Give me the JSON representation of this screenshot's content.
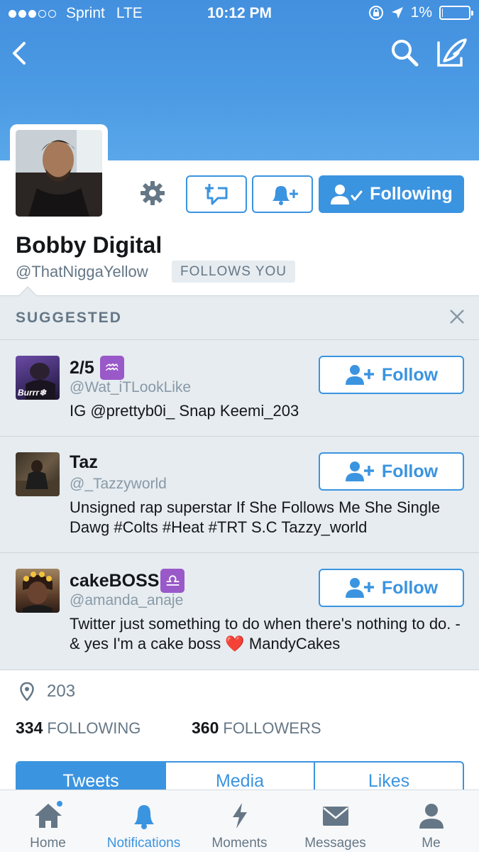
{
  "status_bar": {
    "carrier": "Sprint",
    "network": "LTE",
    "time": "10:12 PM",
    "battery_pct": "1%",
    "battery_level": 0.03
  },
  "profile": {
    "name": "Bobby Digital",
    "handle": "@ThatNiggaYellow",
    "follows_you": "FOLLOWS YOU",
    "following_label": "Following",
    "location": "203",
    "following_count": "334",
    "following_label_caps": "FOLLOWING",
    "followers_count": "360",
    "followers_label_caps": "FOLLOWERS"
  },
  "suggested": {
    "header": "SUGGESTED",
    "follow_label": "Follow",
    "items": [
      {
        "name": "2/5",
        "zodiac": "♒",
        "handle": "@Wat_iTLookLike",
        "bio": "IG @prettyb0i_ Snap Keemi_203",
        "avatar_text": "Burrr❄"
      },
      {
        "name": "Taz",
        "handle": "@_Tazzyworld",
        "bio": "Unsigned rap superstar If She Follows Me She Single Dawg #Colts #Heat #TRT S.C Tazzy_world"
      },
      {
        "name": "cakeBOSS",
        "zodiac": "♎",
        "handle": "@amanda_anaje",
        "bio": "Twitter just something to do when there's nothing to do. - & yes I'm a cake boss ❤️  MandyCakes"
      }
    ]
  },
  "tabs": [
    "Tweets",
    "Media",
    "Likes"
  ],
  "tabbar": [
    {
      "label": "Home",
      "icon": "home-icon"
    },
    {
      "label": "Notifications",
      "icon": "bell-icon"
    },
    {
      "label": "Moments",
      "icon": "lightning-icon"
    },
    {
      "label": "Messages",
      "icon": "envelope-icon"
    },
    {
      "label": "Me",
      "icon": "person-icon"
    }
  ],
  "colors": {
    "accent": "#3b94e0",
    "header": "#4c9be4",
    "muted": "#657786",
    "panel": "#e6ecf0"
  }
}
